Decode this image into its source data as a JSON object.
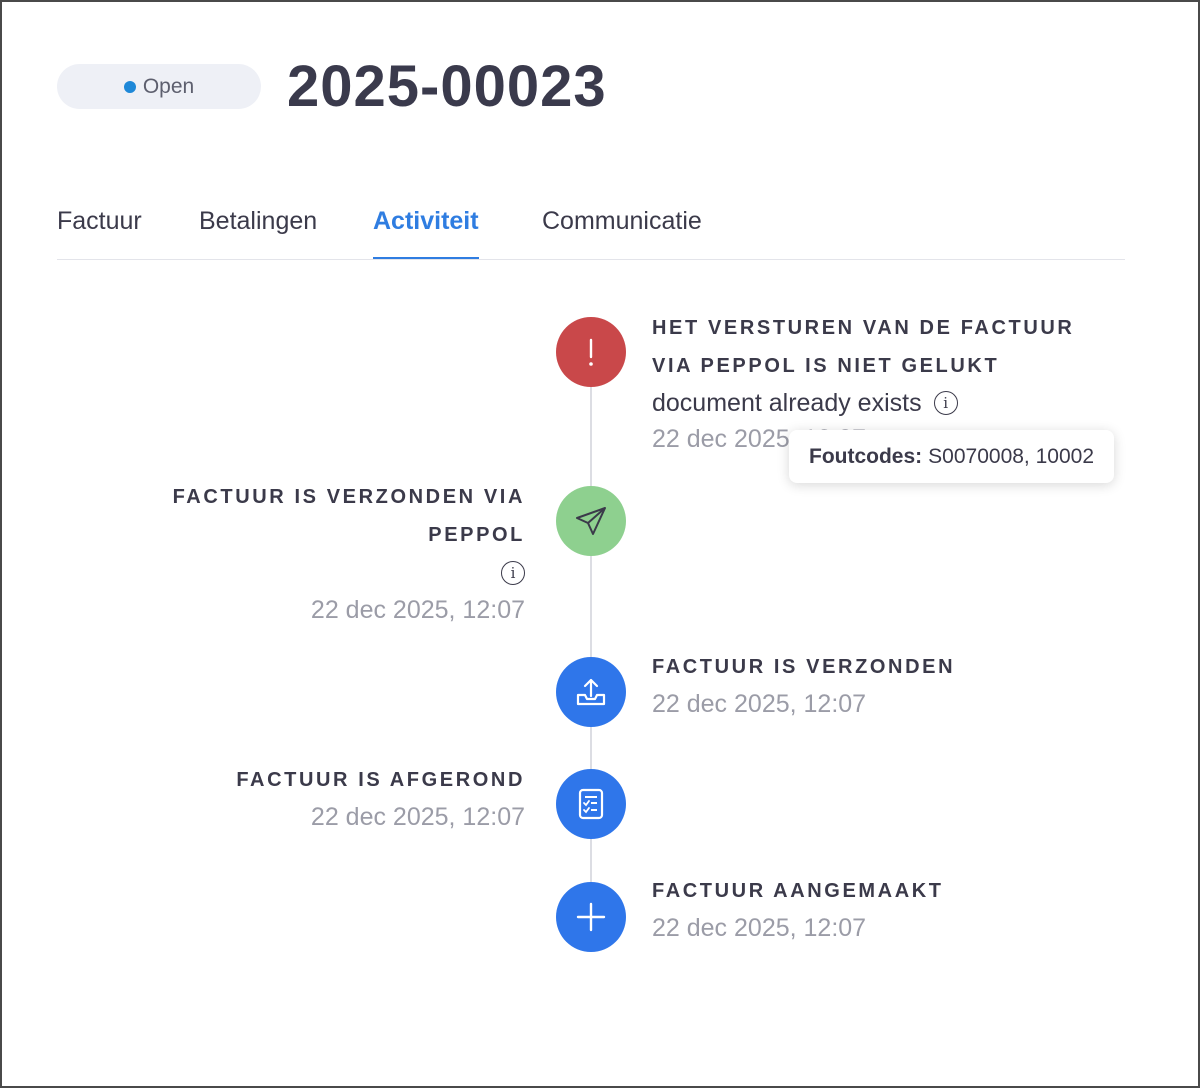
{
  "header": {
    "status_label": "Open",
    "status_color": "#1e88d8",
    "invoice_number": "2025-00023"
  },
  "tabs": [
    {
      "label": "Factuur",
      "active": false
    },
    {
      "label": "Betalingen",
      "active": false
    },
    {
      "label": "Activiteit",
      "active": true
    },
    {
      "label": "Communicatie",
      "active": false
    }
  ],
  "events": [
    {
      "title_line1": "HET VERSTUREN VAN DE FACTUUR",
      "title_line2": "VIA PEPPOL IS NIET GELUKT",
      "description": "document already exists",
      "date": "22 dec 2025, 12:07",
      "icon": "exclamation-icon",
      "color": "#c9484a"
    },
    {
      "title_line1": "FACTUUR IS VERZONDEN VIA",
      "title_line2": "PEPPOL",
      "date": "22 dec 2025, 12:07",
      "icon": "paper-plane-icon",
      "color": "#8ed08f"
    },
    {
      "title": "FACTUUR IS VERZONDEN",
      "date": "22 dec 2025, 12:07",
      "icon": "upload-tray-icon",
      "color": "#2f76ea"
    },
    {
      "title": "FACTUUR IS AFGEROND",
      "date": "22 dec 2025, 12:07",
      "icon": "checklist-icon",
      "color": "#2f76ea"
    },
    {
      "title": "FACTUUR AANGEMAAKT",
      "date": "22 dec 2025, 12:07",
      "icon": "plus-icon",
      "color": "#2f76ea"
    }
  ],
  "tooltip": {
    "label": "Foutcodes:",
    "value": "S0070008, 10002"
  },
  "colors": {
    "accent": "#2f7de1",
    "error": "#c9484a",
    "success": "#8ed08f"
  }
}
